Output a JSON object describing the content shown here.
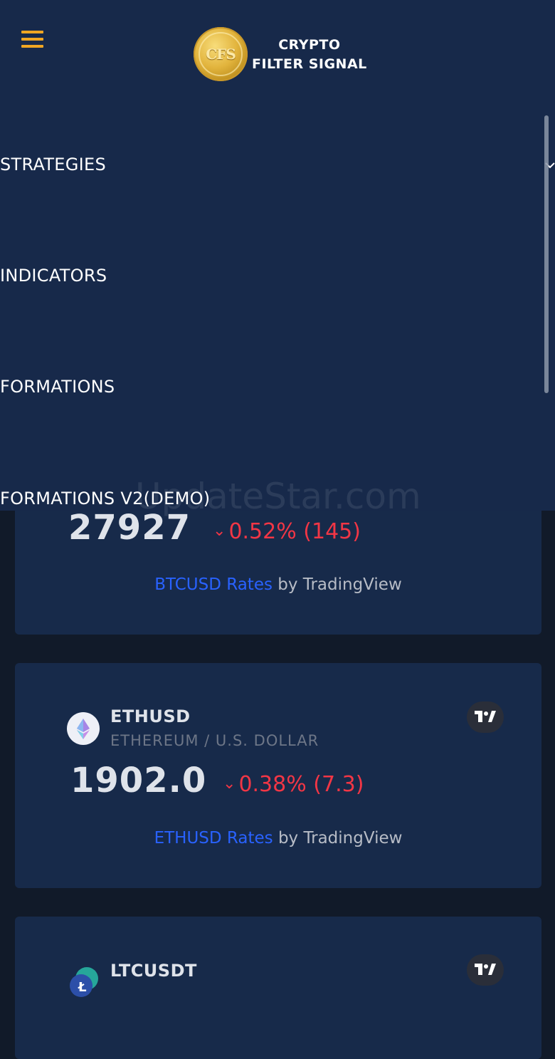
{
  "header": {
    "logo_text": "CFS",
    "brand_line1": "CRYPTO",
    "brand_line2": "FILTER SIGNAL"
  },
  "menu": {
    "items": [
      {
        "label": "STRATEGIES",
        "has_submenu": true
      },
      {
        "label": "INDICATORS"
      },
      {
        "label": "FORMATIONS"
      },
      {
        "label": "FORMATIONS V2(DEMO)"
      }
    ]
  },
  "watermark": "UpdateStar.com",
  "tickers": [
    {
      "price": "27927",
      "change": "0.52% (145)",
      "rates_link": "BTCUSD Rates",
      "rates_suffix": "by TradingView"
    },
    {
      "symbol": "ETHUSD",
      "name": "ETHEREUM / U.S. DOLLAR",
      "price": "1902.0",
      "change": "0.38% (7.3)",
      "rates_link": "ETHUSD Rates",
      "rates_suffix": "by TradingView",
      "badge": "TV"
    },
    {
      "symbol": "LTCUSDT",
      "badge": "TV"
    }
  ],
  "colors": {
    "accent": "#f0a623",
    "negative": "#f23645",
    "link": "#2962ff",
    "menu_bg": "#17294a",
    "page_bg": "#111a29"
  }
}
